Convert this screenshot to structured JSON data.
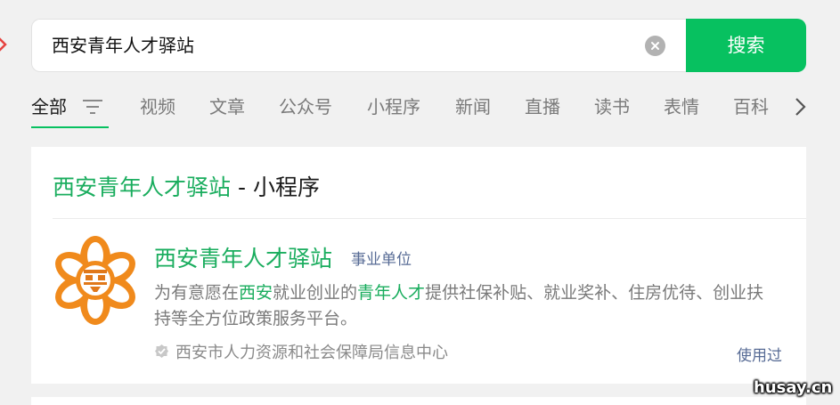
{
  "search": {
    "query": "西安青年人才驿站",
    "button_label": "搜索"
  },
  "tabs": [
    {
      "label": "全部",
      "active": true
    },
    {
      "label": "视频"
    },
    {
      "label": "文章"
    },
    {
      "label": "公众号"
    },
    {
      "label": "小程序"
    },
    {
      "label": "新闻"
    },
    {
      "label": "直播"
    },
    {
      "label": "读书"
    },
    {
      "label": "表情"
    },
    {
      "label": "百科"
    }
  ],
  "result_card": {
    "header_highlight": "西安青年人才驿站",
    "header_separator": " - ",
    "header_suffix": "小程序",
    "app_name": "西安青年人才驿站",
    "app_type": "事业单位",
    "description_parts": [
      {
        "text": "为有意愿在",
        "hl": false
      },
      {
        "text": "西安",
        "hl": true
      },
      {
        "text": "就业创业的",
        "hl": false
      },
      {
        "text": "青年人才",
        "hl": true
      },
      {
        "text": "提供社保补贴、就业奖补、住房优待、创业扶持等全方位政策服务平台。",
        "hl": false
      }
    ],
    "provider": "西安市人力资源和社会保障局信息中心",
    "used_label": "使用过"
  },
  "watermark": "husay.cn",
  "colors": {
    "accent": "#07c160",
    "highlight": "#1aad5e",
    "link": "#576b95",
    "logo_orange": "#f08a1c"
  },
  "icons": {
    "clear": "clear-circle-icon",
    "filter": "filter-lines-icon",
    "more": "chevron-right-icon",
    "verify": "verified-shield-icon",
    "back": "back-arrow-icon",
    "logo": "app-logo-icon"
  }
}
